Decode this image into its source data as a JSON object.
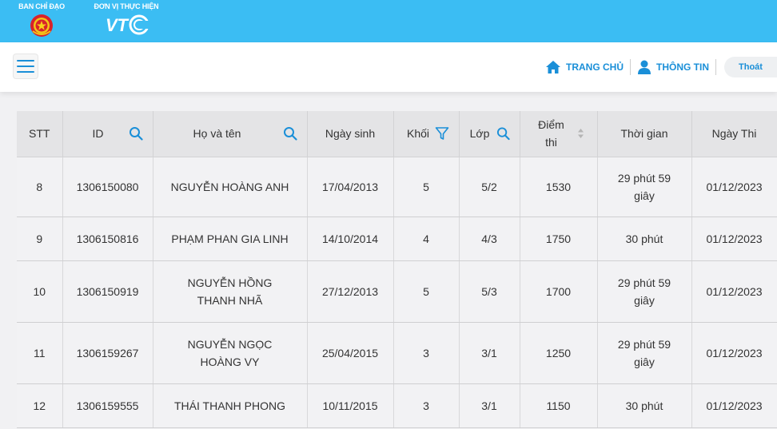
{
  "header": {
    "left_title": "BAN CHỈ ĐẠO",
    "right_title": "ĐƠN VỊ THỰC HIỆN",
    "colors": {
      "bar": "#3bbdf3",
      "accent": "#1a8fd8"
    }
  },
  "navbar": {
    "home_label": "TRANG CHỦ",
    "info_label": "THÔNG TIN",
    "logout_label": "Thoát"
  },
  "table": {
    "columns": {
      "stt": "STT",
      "id": "ID",
      "name": "Họ và tên",
      "dob": "Ngày sinh",
      "grade": "Khối",
      "class": "Lớp",
      "score_line1": "Điểm",
      "score_line2": "thi",
      "time": "Thời gian",
      "date": "Ngày Thi"
    },
    "rows": [
      {
        "stt": "8",
        "id": "1306150080",
        "name": "NGUYỄN HOÀNG ANH",
        "dob": "17/04/2013",
        "grade": "5",
        "class": "5/2",
        "score": "1530",
        "time": "29 phút 59 giây",
        "date": "01/12/2023"
      },
      {
        "stt": "9",
        "id": "1306150816",
        "name": "PHẠM PHAN GIA LINH",
        "dob": "14/10/2014",
        "grade": "4",
        "class": "4/3",
        "score": "1750",
        "time": "30 phút",
        "date": "01/12/2023"
      },
      {
        "stt": "10",
        "id": "1306150919",
        "name": "NGUYỄN HỒNG THANH NHÃ",
        "dob": "27/12/2013",
        "grade": "5",
        "class": "5/3",
        "score": "1700",
        "time": "29 phút 59 giây",
        "date": "01/12/2023"
      },
      {
        "stt": "11",
        "id": "1306159267",
        "name": "NGUYỄN NGỌC HOÀNG VY",
        "dob": "25/04/2015",
        "grade": "3",
        "class": "3/1",
        "score": "1250",
        "time": "29 phút 59 giây",
        "date": "01/12/2023"
      },
      {
        "stt": "12",
        "id": "1306159555",
        "name": "THÁI THANH PHONG",
        "dob": "10/11/2015",
        "grade": "3",
        "class": "3/1",
        "score": "1150",
        "time": "30 phút",
        "date": "01/12/2023"
      }
    ]
  }
}
